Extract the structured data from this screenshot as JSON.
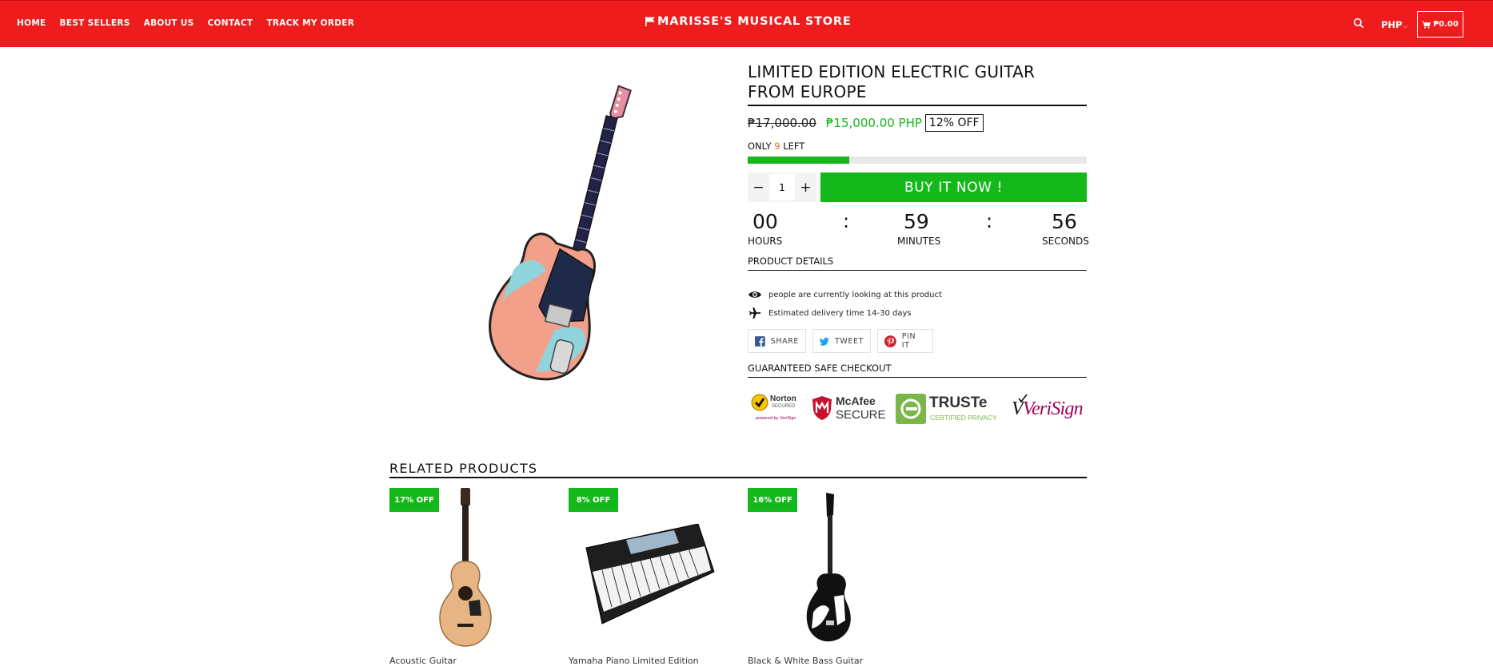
{
  "header": {
    "nav": [
      "HOME",
      "BEST SELLERS",
      "ABOUT US",
      "CONTACT",
      "TRACK MY ORDER"
    ],
    "logo_text": "MARISSE'S MUSICAL STORE",
    "currency": "PHP",
    "cart_total": "₱0.00",
    "colors": {
      "bar": "#ee1c1c"
    }
  },
  "product": {
    "title": "LIMITED EDITION ELECTRIC GUITAR FROM EUROPE",
    "old_price": "₱17,000.00",
    "new_price": "₱15,000.00 PHP",
    "discount": "12% OFF",
    "stock_prefix": "ONLY",
    "stock_count": "9",
    "stock_suffix": "LEFT",
    "stock_bar_fraction": 0.3,
    "quantity": "1",
    "qty_minus": "−",
    "qty_plus": "+",
    "buy_label": "BUY IT NOW !",
    "countdown": {
      "hours": "00",
      "minutes": "59",
      "seconds": "56",
      "separator": ":",
      "hours_label": "HOURS",
      "minutes_label": "MINUTES",
      "seconds_label": "SECONDS"
    },
    "details_heading": "PRODUCT DETAILS",
    "viewers_text": "people are currently looking at this product",
    "delivery_text": "Estimated delivery time 14-30 days",
    "share": {
      "facebook": "SHARE",
      "twitter": "TWEET",
      "pinterest": "PIN IT"
    },
    "checkout_heading": "GUARANTEED SAFE CHECKOUT",
    "trust_badges": {
      "norton": {
        "line1": "Norton",
        "line2": "SECURED",
        "line3": "powered by VeriSign"
      },
      "mcafee": {
        "line1": "McAfee",
        "line2": "SECURE"
      },
      "truste": {
        "line1": "TRUSTe",
        "line2": "CERTIFIED PRIVACY"
      },
      "verisign": "VeriSign"
    },
    "accent": "#14b81b"
  },
  "related": {
    "heading": "RELATED PRODUCTS",
    "items": [
      {
        "badge": "17% OFF",
        "name": "Acoustic Guitar",
        "icon": "acoustic-guitar"
      },
      {
        "badge": "8% OFF",
        "name": "Yamaha Piano Limited Edition",
        "icon": "keyboard"
      },
      {
        "badge": "16% OFF",
        "name": "Black & White Bass Guitar",
        "icon": "electric-guitar"
      }
    ]
  }
}
